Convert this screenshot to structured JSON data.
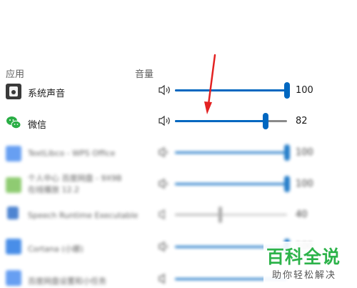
{
  "header": {
    "app_col": "应用",
    "volume_col": "音量"
  },
  "apps": [
    {
      "name": "系统声音",
      "volume": 100,
      "value": "100"
    },
    {
      "name": "微信",
      "volume": 82,
      "value": "82"
    },
    {
      "name": "TextLibco - WPS Office",
      "volume": 100,
      "value": "100"
    },
    {
      "name": "个人中心 百度网盘 - 9X9B",
      "name2": "在线播放 12.2",
      "volume": 100,
      "value": "100"
    },
    {
      "name": "Speech Runtime Executable",
      "volume": 40,
      "value": "40"
    },
    {
      "name": "Cortana (小娜)",
      "volume": 100,
      "value": "100"
    },
    {
      "name": "百度网盘设置和小任务",
      "volume": 100,
      "value": ""
    }
  ],
  "watermark": {
    "title": "百科全说",
    "subtitle": "助你轻松解决"
  },
  "colors": {
    "accent": "#0067c0",
    "annotation_arrow": "#e32222",
    "watermark_green": "#2db34a"
  }
}
